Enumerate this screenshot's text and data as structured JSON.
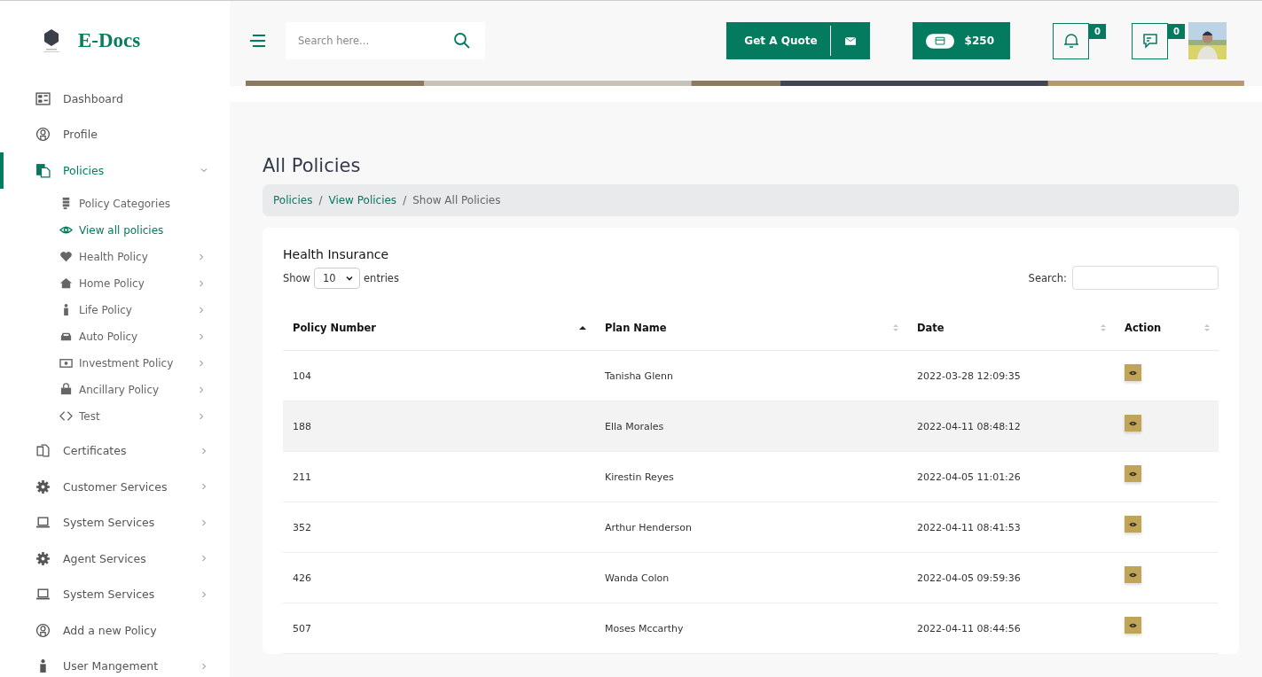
{
  "brand": {
    "name": "E-Docs"
  },
  "sidebar": {
    "items": [
      {
        "label": "Dashboard",
        "selected": false,
        "expandable": false
      },
      {
        "label": "Profile",
        "selected": false,
        "expandable": false
      },
      {
        "label": "Policies",
        "selected": true,
        "expandable": true,
        "expanded": true,
        "children": [
          {
            "label": "Policy Categories",
            "selected": false,
            "expandable": false
          },
          {
            "label": "View all policies",
            "selected": true,
            "expandable": false
          },
          {
            "label": "Health Policy",
            "selected": false,
            "expandable": true
          },
          {
            "label": "Home Policy",
            "selected": false,
            "expandable": true
          },
          {
            "label": "Life Policy",
            "selected": false,
            "expandable": true
          },
          {
            "label": "Auto Policy",
            "selected": false,
            "expandable": true
          },
          {
            "label": "Investment Policy",
            "selected": false,
            "expandable": true
          },
          {
            "label": "Ancillary Policy",
            "selected": false,
            "expandable": true
          },
          {
            "label": "Test",
            "selected": false,
            "expandable": true
          }
        ]
      },
      {
        "label": "Certificates",
        "selected": false,
        "expandable": true
      },
      {
        "label": "Customer Services",
        "selected": false,
        "expandable": true
      },
      {
        "label": "System Services",
        "selected": false,
        "expandable": true
      },
      {
        "label": "Agent Services",
        "selected": false,
        "expandable": true
      },
      {
        "label": "System Services",
        "selected": false,
        "expandable": true
      },
      {
        "label": "Add a new Policy",
        "selected": false,
        "expandable": false
      },
      {
        "label": "User Mangement",
        "selected": false,
        "expandable": true
      }
    ]
  },
  "header": {
    "search": {
      "placeholder": "Search here..."
    },
    "quote_button": "Get A Quote",
    "balance": "$250",
    "notifications": "0",
    "messages": "0"
  },
  "page": {
    "title": "All Policies",
    "breadcrumb_separator": "/",
    "breadcrumb": [
      "Policies",
      "View Policies",
      "Show All Policies"
    ]
  },
  "card": {
    "title": "Health Insurance",
    "show_label": "Show",
    "page_size": "10",
    "entries_label": "entries",
    "search_label": "Search:",
    "columns": [
      {
        "label": "Policy Number",
        "sorted": true
      },
      {
        "label": "Plan Name",
        "sorted": false
      },
      {
        "label": "Date",
        "sorted": false
      },
      {
        "label": "Action",
        "sorted": false
      }
    ],
    "rows": [
      {
        "number": "104",
        "plan": "Tanisha Glenn",
        "date": "2022-03-28 12:09:35",
        "selected": false
      },
      {
        "number": "188",
        "plan": "Ella Morales",
        "date": "2022-04-11 08:48:12",
        "selected": true
      },
      {
        "number": "211",
        "plan": "Kirestin Reyes",
        "date": "2022-04-05 11:01:26",
        "selected": false
      },
      {
        "number": "352",
        "plan": "Arthur Henderson",
        "date": "2022-04-11 08:41:53",
        "selected": false
      },
      {
        "number": "426",
        "plan": "Wanda Colon",
        "date": "2022-04-05 09:59:36",
        "selected": false
      },
      {
        "number": "507",
        "plan": "Moses Mccarthy",
        "date": "2022-04-11 08:44:56",
        "selected": false
      }
    ]
  }
}
